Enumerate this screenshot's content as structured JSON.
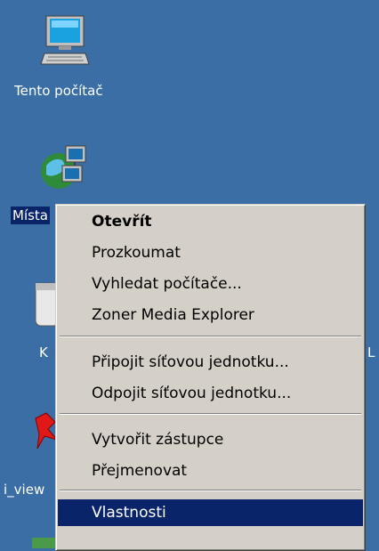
{
  "desktop": {
    "icons": [
      {
        "label": "Tento počítač",
        "icon": "my-computer-icon"
      },
      {
        "label": "Místa",
        "icon": "network-places-icon"
      },
      {
        "label": "K",
        "icon": "recycle-bin-icon"
      },
      {
        "label": "i_view",
        "icon": "irfanview-icon"
      },
      {
        "label": "L",
        "icon": "partial-icon"
      }
    ]
  },
  "context_menu": {
    "items": [
      {
        "label": "Otevřít",
        "default": true
      },
      {
        "label": "Prozkoumat"
      },
      {
        "label": "Vyhledat počítače..."
      },
      {
        "label": "Zoner Media Explorer"
      },
      {
        "label": "Připojit síťovou jednotku..."
      },
      {
        "label": "Odpojit síťovou jednotku..."
      },
      {
        "label": "Vytvořit zástupce"
      },
      {
        "label": "Přejmenovat"
      },
      {
        "label": "Vlastnosti",
        "highlighted": true
      }
    ]
  },
  "colors": {
    "desktop_bg": "#3a6ea5",
    "menu_bg": "#d4d0c8",
    "selection": "#0a246a"
  }
}
